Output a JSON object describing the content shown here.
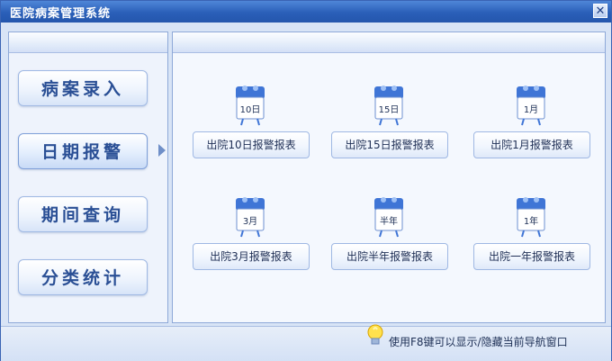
{
  "window": {
    "title": "医院病案管理系统"
  },
  "nav": {
    "items": [
      {
        "label": "病案录入"
      },
      {
        "label": "日期报警"
      },
      {
        "label": "期间查询"
      },
      {
        "label": "分类统计"
      }
    ]
  },
  "reports": [
    {
      "cal_text": "10日",
      "button": "出院10日报警报表"
    },
    {
      "cal_text": "15日",
      "button": "出院15日报警报表"
    },
    {
      "cal_text": "1月",
      "button": "出院1月报警报表"
    },
    {
      "cal_text": "3月",
      "button": "出院3月报警报表"
    },
    {
      "cal_text": "半年",
      "button": "出院半年报警报表"
    },
    {
      "cal_text": "1年",
      "button": "出院一年报警报表"
    }
  ],
  "status": {
    "hint": "使用F8键可以显示/隐藏当前导航窗口"
  },
  "colors": {
    "accent": "#2a5fb8",
    "calendar": "#3f75d6"
  }
}
